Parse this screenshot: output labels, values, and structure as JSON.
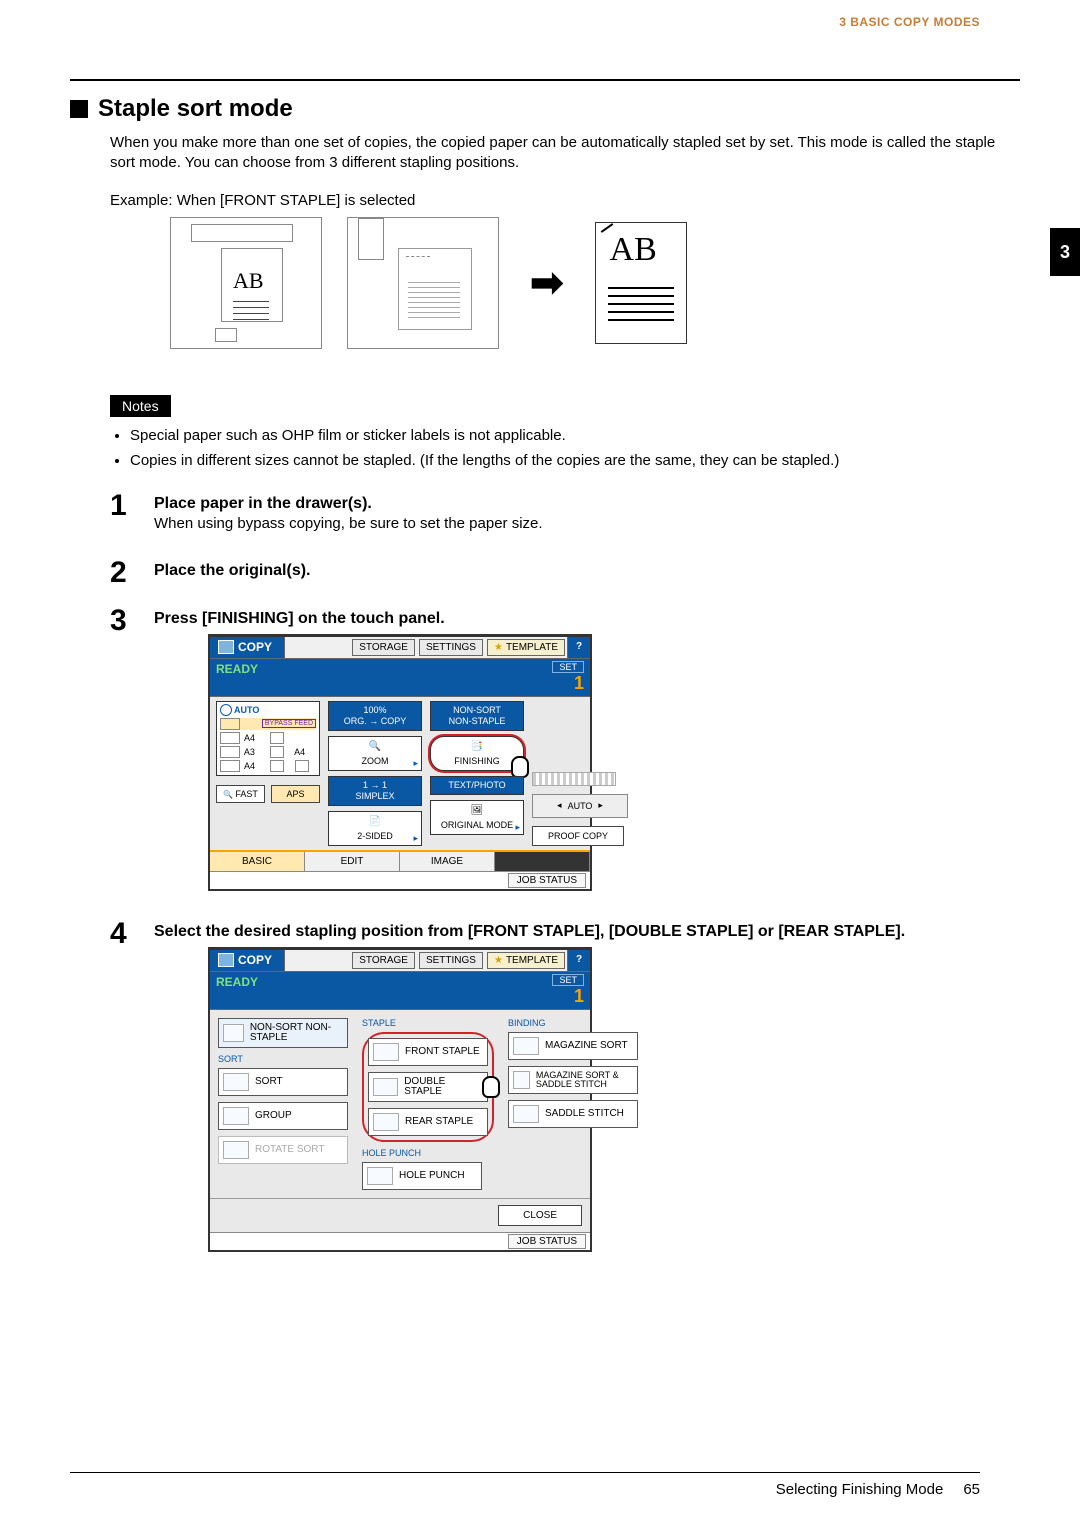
{
  "runningHead": "3 BASIC COPY MODES",
  "chapterTab": "3",
  "heading": "Staple sort mode",
  "intro": "When you make more than one set of copies, the copied paper can be automatically stapled set by set. This mode is called the staple sort mode. You can choose from 3 different stapling positions.",
  "exampleLabel": "Example: When [FRONT STAPLE] is selected",
  "illus": {
    "ab": "AB"
  },
  "notesBadge": "Notes",
  "notes": [
    "Special paper such as OHP film or sticker labels is not applicable.",
    "Copies in different sizes cannot be stapled. (If the lengths of the copies are the same, they can be stapled.)"
  ],
  "steps": {
    "s1": {
      "num": "1",
      "title": "Place paper in the drawer(s).",
      "desc": "When using bypass copying, be sure to set the paper size."
    },
    "s2": {
      "num": "2",
      "title": "Place the original(s)."
    },
    "s3": {
      "num": "3",
      "title": "Press [FINISHING] on the touch panel."
    },
    "s4": {
      "num": "4",
      "title": "Select the desired stapling position from [FRONT STAPLE], [DOUBLE STAPLE] or [REAR STAPLE]."
    }
  },
  "panel1": {
    "copy": "COPY",
    "storage": "STORAGE",
    "settings": "SETTINGS",
    "template": "TEMPLATE",
    "help": "?",
    "ready": "READY",
    "setLabel": "SET",
    "setCount": "1",
    "auto": "AUTO",
    "bypass": "BYPASS FEED",
    "drawers": {
      "d1": "A4",
      "d2": "A3",
      "d3": "A4",
      "side": "A4"
    },
    "fastBtn": "FAST",
    "apsBtn": "APS",
    "zoomPct": "100%",
    "orgCopy": "ORG. → COPY",
    "zoom": "ZOOM",
    "simplex1": "1 → 1",
    "simplex2": "SIMPLEX",
    "twoSided": "2-SIDED",
    "nonSort1": "NON-SORT",
    "nonSort2": "NON-STAPLE",
    "finishing": "FINISHING",
    "textPhoto": "TEXT/PHOTO",
    "origMode": "ORIGINAL MODE",
    "autoGray": "AUTO",
    "proof": "PROOF COPY",
    "tabs": {
      "basic": "BASIC",
      "edit": "EDIT",
      "image": "IMAGE"
    },
    "jobStatus": "JOB STATUS"
  },
  "panel2": {
    "copy": "COPY",
    "storage": "STORAGE",
    "settings": "SETTINGS",
    "template": "TEMPLATE",
    "help": "?",
    "ready": "READY",
    "setLabel": "SET",
    "setCount": "1",
    "groups": {
      "staple": "STAPLE",
      "binding": "BINDING",
      "hole": "HOLE PUNCH",
      "sort": "SORT"
    },
    "opts": {
      "nonSort": "NON-SORT NON-STAPLE",
      "sort": "SORT",
      "group": "GROUP",
      "rotate": "ROTATE SORT",
      "front": "FRONT STAPLE",
      "double": "DOUBLE STAPLE",
      "rear": "REAR STAPLE",
      "hole": "HOLE PUNCH",
      "magSort": "MAGAZINE SORT",
      "magSaddle": "MAGAZINE SORT & SADDLE STITCH",
      "saddle": "SADDLE STITCH"
    },
    "close": "CLOSE",
    "jobStatus": "JOB STATUS"
  },
  "footer": {
    "section": "Selecting Finishing Mode",
    "page": "65"
  }
}
